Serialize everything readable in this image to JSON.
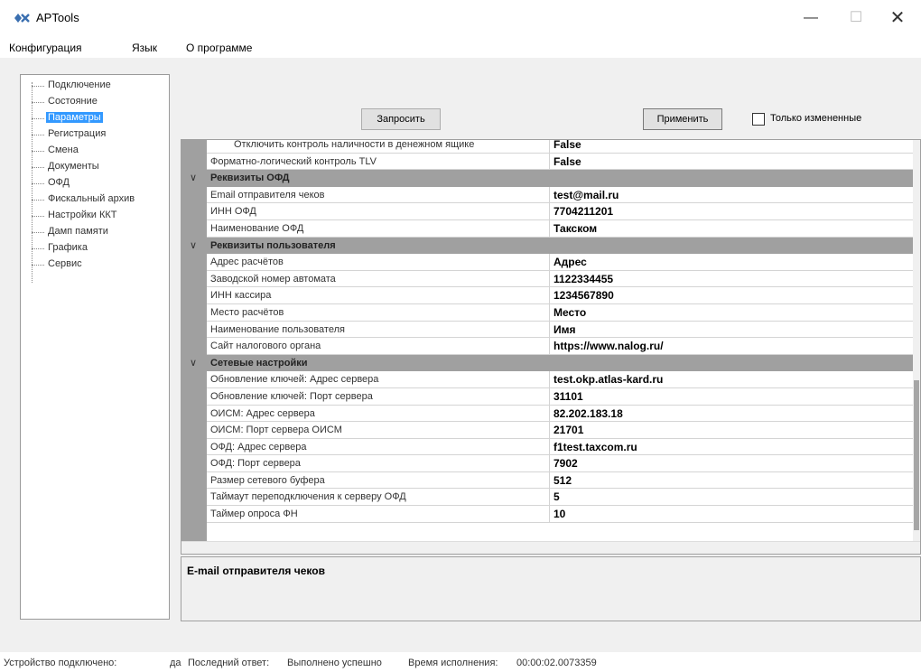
{
  "window": {
    "title": "APTools"
  },
  "menu": [
    "Конфигурация",
    "Язык",
    "О программе"
  ],
  "tree": {
    "items": [
      "Подключение",
      "Состояние",
      "Параметры",
      "Регистрация",
      "Смена",
      "Документы",
      "ОФД",
      "Фискальный архив",
      "Настройки ККТ",
      "Дамп памяти",
      "Графика",
      "Сервис"
    ],
    "selected": "Параметры"
  },
  "toolbar": {
    "query_label": "Запросить",
    "apply_label": "Применить",
    "only_changed_label": "Только измененные",
    "only_changed_checked": false
  },
  "grid": {
    "rows": [
      {
        "type": "prop",
        "name": "Отключить контроль наличности в денежном ящике",
        "value": "False"
      },
      {
        "type": "prop",
        "name": "Форматно-логический контроль TLV",
        "value": "False"
      },
      {
        "type": "cat",
        "name": "Реквизиты ОФД"
      },
      {
        "type": "prop",
        "name": "Email отправителя чеков",
        "value": "test@mail.ru"
      },
      {
        "type": "prop",
        "name": "ИНН ОФД",
        "value": "7704211201"
      },
      {
        "type": "prop",
        "name": "Наименование ОФД",
        "value": "Такском"
      },
      {
        "type": "cat",
        "name": "Реквизиты пользователя"
      },
      {
        "type": "prop",
        "name": "Адрес расчётов",
        "value": "Адрес"
      },
      {
        "type": "prop",
        "name": "Заводской номер автомата",
        "value": "1122334455"
      },
      {
        "type": "prop",
        "name": "ИНН кассира",
        "value": "1234567890"
      },
      {
        "type": "prop",
        "name": "Место расчётов",
        "value": "Место"
      },
      {
        "type": "prop",
        "name": "Наименование пользователя",
        "value": "Имя"
      },
      {
        "type": "prop",
        "name": "Сайт налогового органа",
        "value": "https://www.nalog.ru/"
      },
      {
        "type": "cat",
        "name": "Сетевые настройки"
      },
      {
        "type": "prop",
        "name": "Обновление ключей: Адрес сервера",
        "value": "test.okp.atlas-kard.ru"
      },
      {
        "type": "prop",
        "name": "Обновление ключей: Порт сервера",
        "value": "31101"
      },
      {
        "type": "prop",
        "name": "ОИСМ: Адрес сервера",
        "value": "82.202.183.18"
      },
      {
        "type": "prop",
        "name": "ОИСМ: Порт сервера ОИСМ",
        "value": "21701"
      },
      {
        "type": "prop",
        "name": "ОФД: Адрес сервера",
        "value": "f1test.taxcom.ru"
      },
      {
        "type": "prop",
        "name": "ОФД: Порт сервера",
        "value": "7902"
      },
      {
        "type": "prop",
        "name": "Размер сетевого буфера",
        "value": "512"
      },
      {
        "type": "prop",
        "name": "Таймаут переподключения к серверу ОФД",
        "value": "5"
      },
      {
        "type": "prop",
        "name": "Таймер опроса ФН",
        "value": "10"
      }
    ]
  },
  "description": {
    "title": "E-mail отправителя чеков"
  },
  "status": {
    "connected_label": "Устройство подключено:",
    "connected_value": "да",
    "last_answer_label": "Последний ответ:",
    "last_answer_value": "Выполнено успешно",
    "exec_time_label": "Время исполнения:",
    "exec_time_value": "00:00:02.0073359"
  },
  "colors": {
    "selection": "#3399ff",
    "category_row": "#a0a0a0",
    "app_icon": "#3a6fb0"
  }
}
